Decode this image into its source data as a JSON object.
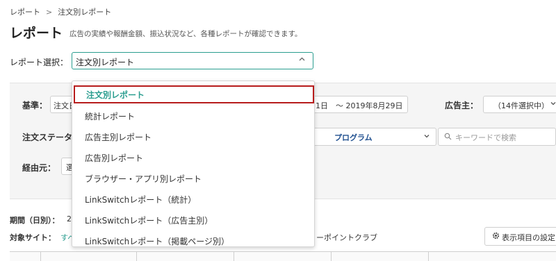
{
  "breadcrumb": {
    "items": [
      "レポート",
      "注文別レポート"
    ],
    "separator": ">"
  },
  "page": {
    "title": "レポート",
    "description": "広告の実績や報酬金額、振込状況など、各種レポートが確認できます。"
  },
  "report_select": {
    "label": "レポート選択：",
    "value": "注文別レポート",
    "options": [
      "注文別レポート",
      "統計レポート",
      "広告主別レポート",
      "広告別レポート",
      "ブラウザー・アプリ別レポート",
      "LinkSwitchレポート（統計）",
      "LinkSwitchレポート（広告主別）",
      "LinkSwitchレポート（掲載ページ別）"
    ]
  },
  "filters": {
    "basis_label": "基準：",
    "basis_value": "注文日",
    "date_range": "1日　～ 2019年8月29日",
    "advertiser_label": "広告主：",
    "advertiser_value": "（14件選択中）",
    "order_status_label": "注文ステータ",
    "program_value": "プログラム",
    "keyword_placeholder": "キーワードで検索",
    "via_label": "経由元：",
    "via_button": "選"
  },
  "summary": {
    "period_label": "期間（日別）：",
    "period_value": "2",
    "target_site_label": "対象サイト：",
    "target_site_value": "すべ",
    "site_name": "ーポイントクラブ",
    "settings_button": "表示項目の設定"
  },
  "colors": {
    "accent": "#2a9d8f",
    "highlight": "#b71c1c",
    "program_text": "#1f4f8f"
  }
}
